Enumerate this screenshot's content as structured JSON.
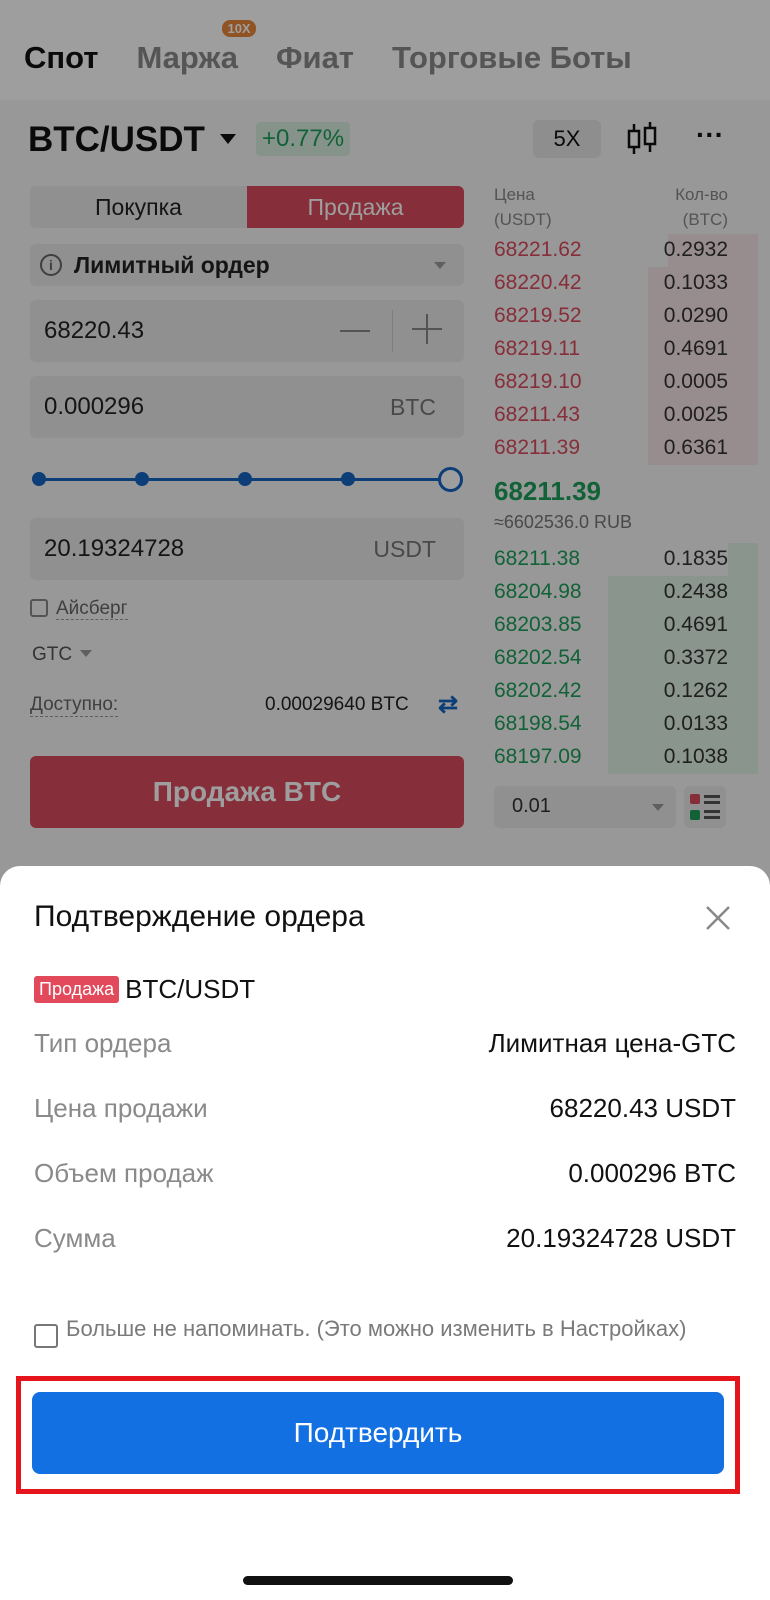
{
  "tabs": [
    "Спот",
    "Маржа",
    "Фиат",
    "Торговые Боты"
  ],
  "margin_badge": "10X",
  "pair": {
    "name": "BTC/USDT",
    "change": "+0.77%",
    "leverage": "5X"
  },
  "trade": {
    "buy_label": "Покупка",
    "sell_label": "Продажа",
    "order_type": "Лимитный ордер",
    "price": "68220.43",
    "amount": "0.000296",
    "amount_unit": "BTC",
    "total": "20.19324728",
    "total_unit": "USDT",
    "slider_percent": 100,
    "iceberg_label": "Айсберг",
    "tif": "GTC",
    "available_label": "Доступно:",
    "available_value": "0.00029640 BTC",
    "submit_label": "Продажа  BTC"
  },
  "orderbook": {
    "price_header": "Цена",
    "price_unit": "(USDT)",
    "qty_header": "Кол-во",
    "qty_unit": "(BTC)",
    "asks": [
      {
        "price": "68221.62",
        "qty": "0.2932"
      },
      {
        "price": "68220.42",
        "qty": "0.1033"
      },
      {
        "price": "68219.52",
        "qty": "0.0290"
      },
      {
        "price": "68219.11",
        "qty": "0.4691"
      },
      {
        "price": "68219.10",
        "qty": "0.0005"
      },
      {
        "price": "68211.43",
        "qty": "0.0025"
      },
      {
        "price": "68211.39",
        "qty": "0.6361"
      }
    ],
    "last_price": "68211.39",
    "last_price_rub": "≈6602536.0 RUB",
    "bids": [
      {
        "price": "68211.38",
        "qty": "0.1835"
      },
      {
        "price": "68204.98",
        "qty": "0.2438"
      },
      {
        "price": "68203.85",
        "qty": "0.4691"
      },
      {
        "price": "68202.54",
        "qty": "0.3372"
      },
      {
        "price": "68202.42",
        "qty": "0.1262"
      },
      {
        "price": "68198.54",
        "qty": "0.0133"
      },
      {
        "price": "68197.09",
        "qty": "0.1038"
      }
    ],
    "depth": "0.01"
  },
  "modal": {
    "title": "Подтверждение ордера",
    "side_tag": "Продажа",
    "pair": "BTC/USDT",
    "rows": [
      {
        "label": "Тип ордера",
        "value": "Лимитная цена-GTC"
      },
      {
        "label": "Цена продажи",
        "value": "68220.43 USDT"
      },
      {
        "label": "Объем продаж",
        "value": "0.000296 BTC"
      },
      {
        "label": "Сумма",
        "value": "20.19324728 USDT"
      }
    ],
    "remind_text": "Больше не напоминать. (Это можно изменить в Настройках)",
    "confirm_label": "Подтвердить"
  },
  "colors": {
    "sell": "#d94b5c",
    "buy": "#1e9e5a",
    "accent": "#1270e3",
    "highlight": "#e5151b"
  }
}
